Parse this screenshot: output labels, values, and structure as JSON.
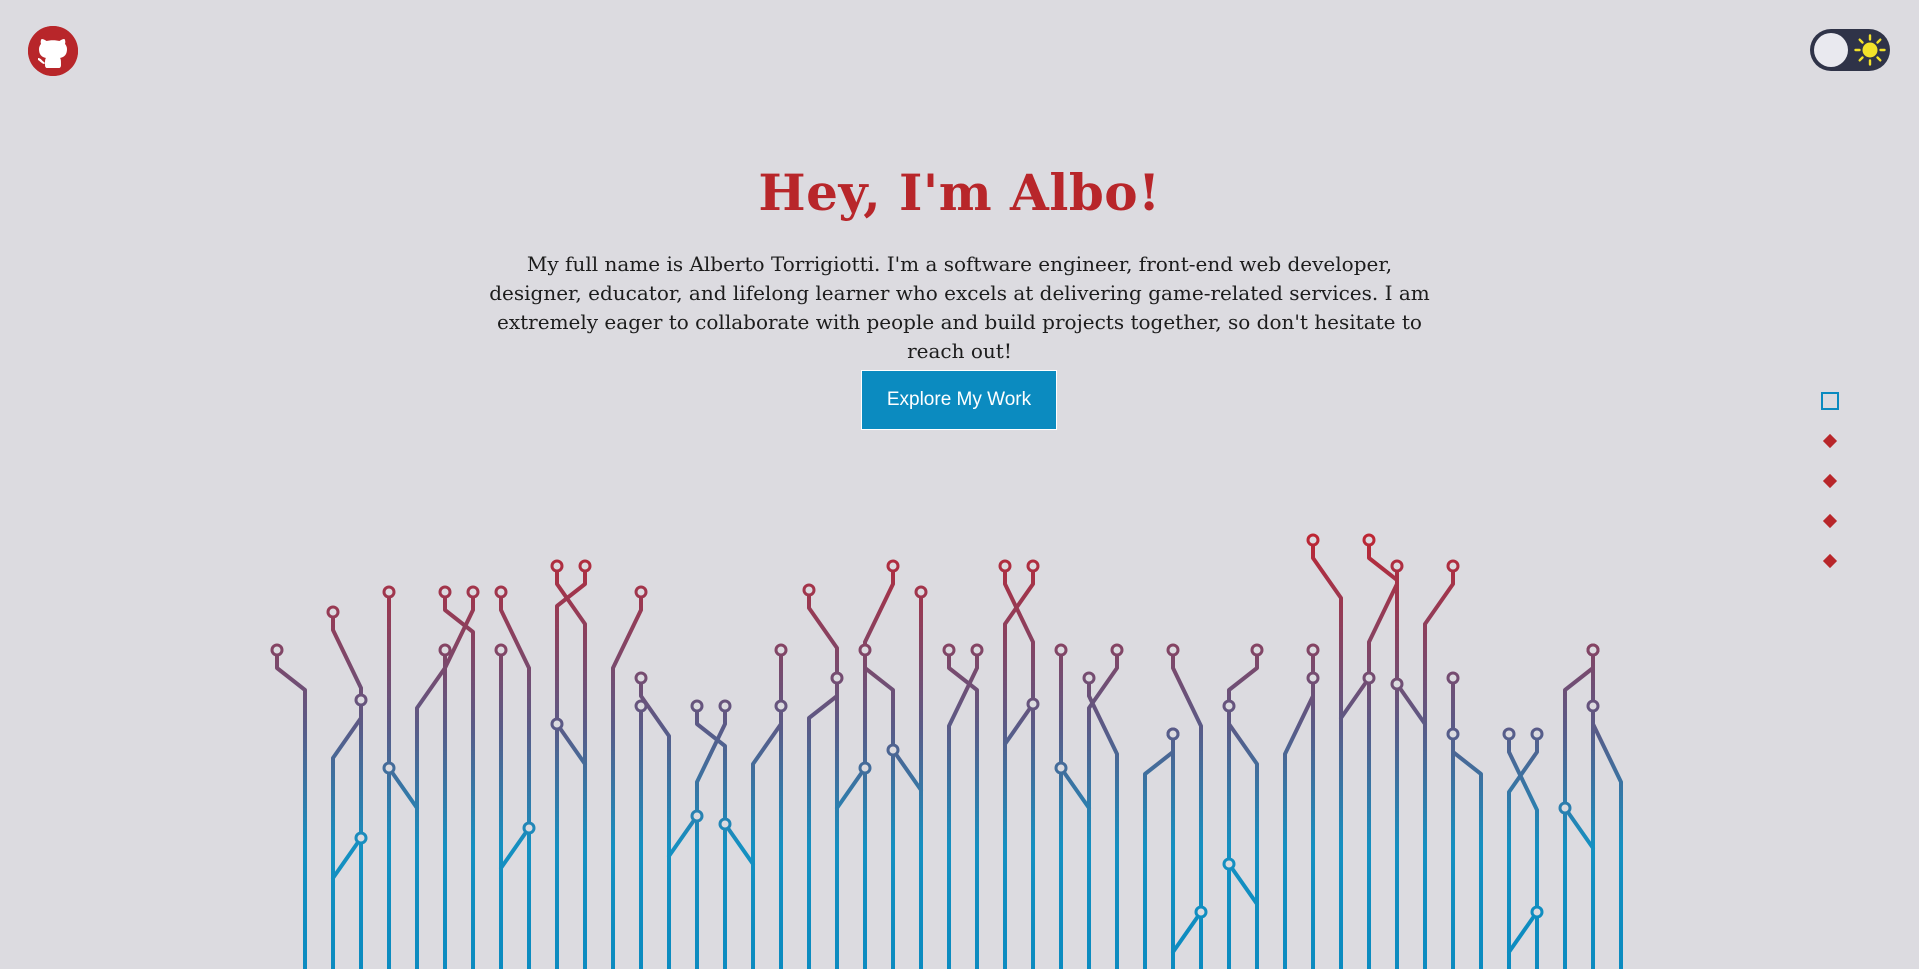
{
  "header": {
    "github_icon": "github-icon",
    "theme_icon": "sun-icon"
  },
  "hero": {
    "title": "Hey, I'm Albo!",
    "description": "My full name is Alberto Torrigiotti. I'm a software engineer, front-end web developer, designer, educator, and lifelong learner who excels at delivering game-related services. I am extremely eager to collaborate with people and build projects together, so don't hesitate to reach out!",
    "cta_label": "Explore My Work"
  },
  "section_nav": {
    "active_index": 0,
    "count": 5
  },
  "colors": {
    "background": "#dcdbe0",
    "accent_red": "#b8262a",
    "accent_blue": "#0b8bc0",
    "toggle_bg": "#2f3348",
    "sun": "#f3e22a"
  }
}
